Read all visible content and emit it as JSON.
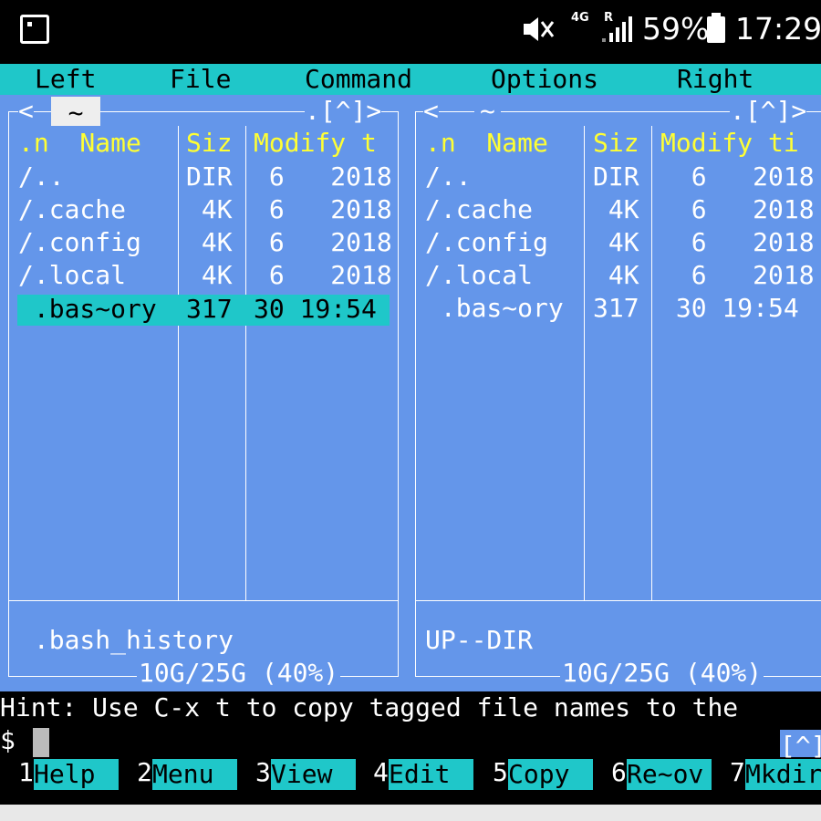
{
  "status_bar": {
    "network": "4G",
    "roaming": "R",
    "battery": "59%",
    "time": "17:29"
  },
  "menu": [
    "Left",
    "File",
    "Command",
    "Options",
    "Right"
  ],
  "left_panel": {
    "path": "~",
    "top_right": ".[^]>",
    "headers": {
      "name": ".n  Name",
      "size": "Siz",
      "modify": "Modify t"
    },
    "rows": [
      {
        "name": "/..",
        "size": "DIR",
        "modify": " 6   2018"
      },
      {
        "name": "/.cache",
        "size": " 4K",
        "modify": " 6   2018"
      },
      {
        "name": "/.config",
        "size": " 4K",
        "modify": " 6   2018"
      },
      {
        "name": "/.local",
        "size": " 4K",
        "modify": " 6   2018"
      },
      {
        "name": " .bas~ory",
        "size": "317",
        "modify": "30 19:54"
      }
    ],
    "status": " .bash_history",
    "free": "10G/25G (40%)"
  },
  "right_panel": {
    "path": "~",
    "top_right": ".[^]>",
    "headers": {
      "name": ".n  Name",
      "size": "Siz",
      "modify": "Modify ti"
    },
    "rows": [
      {
        "name": "/..",
        "size": "DIR",
        "modify": "  6   2018"
      },
      {
        "name": "/.cache",
        "size": " 4K",
        "modify": "  6   2018"
      },
      {
        "name": "/.config",
        "size": " 4K",
        "modify": "  6   2018"
      },
      {
        "name": "/.local",
        "size": " 4K",
        "modify": "  6   2018"
      },
      {
        "name": " .bas~ory",
        "size": "317",
        "modify": " 30 19:54"
      }
    ],
    "status": "UP--DIR",
    "free": "10G/25G (40%)"
  },
  "hint": "Hint: Use C-x t to copy tagged file names to the",
  "prompt": "$",
  "prompt_corner": "[^]",
  "fkeys": [
    {
      "num": "1",
      "label": "Help"
    },
    {
      "num": "2",
      "label": "Menu"
    },
    {
      "num": "3",
      "label": "View"
    },
    {
      "num": "4",
      "label": "Edit"
    },
    {
      "num": "5",
      "label": "Copy"
    },
    {
      "num": "6",
      "label": "Re~ov"
    },
    {
      "num": "7",
      "label": "Mkdir"
    }
  ]
}
